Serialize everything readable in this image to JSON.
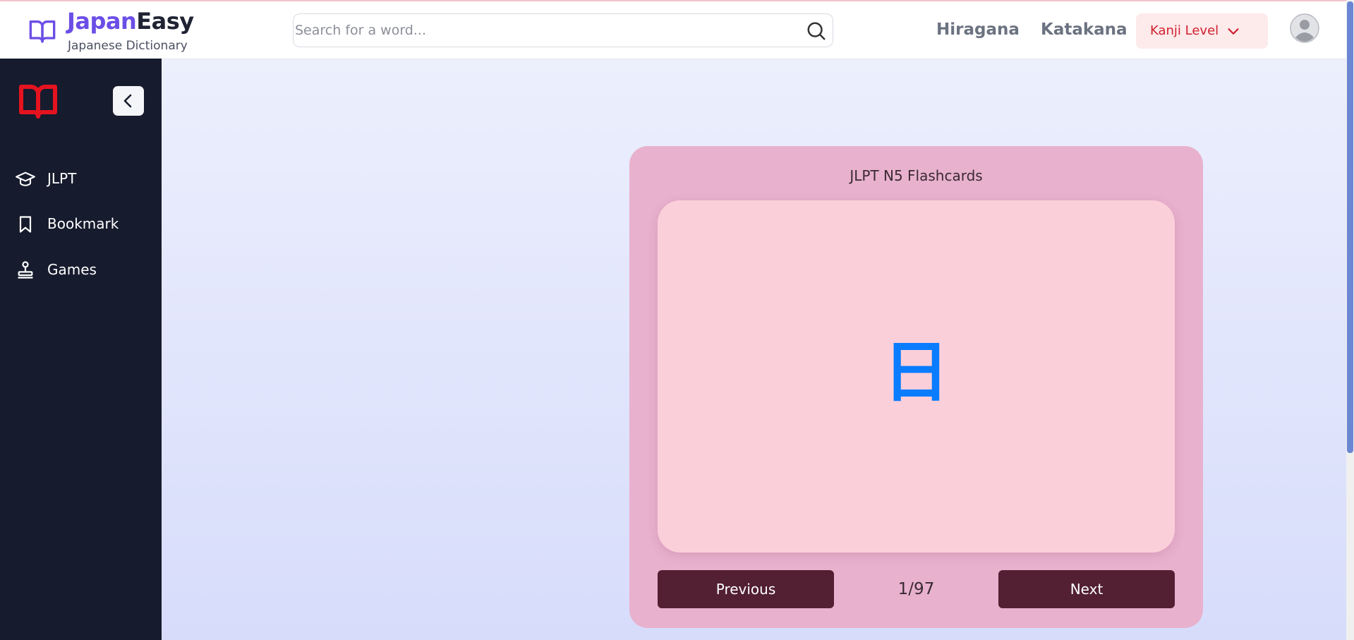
{
  "header": {
    "brand_part1": "Japan",
    "brand_part2": "Easy",
    "subtitle": "Japanese Dictionary",
    "search_placeholder": "Search for a word...",
    "nav": [
      "Hiragana",
      "Katakana"
    ],
    "kanji_level_label": "Kanji Level",
    "icons": {
      "logo": "open-book-icon",
      "search": "search-icon",
      "dropdown": "chevron-down-icon",
      "avatar": "user-avatar-icon"
    }
  },
  "sidebar": {
    "items": [
      {
        "label": "JLPT",
        "icon": "graduation-cap-icon"
      },
      {
        "label": "Bookmark",
        "icon": "bookmark-icon"
      },
      {
        "label": "Games",
        "icon": "joystick-icon"
      }
    ],
    "icons": {
      "logo": "open-book-icon",
      "collapse": "chevron-left-icon"
    }
  },
  "flashcards": {
    "title": "JLPT N5 Flashcards",
    "character": "日",
    "previous_label": "Previous",
    "next_label": "Next",
    "counter": "1/97"
  },
  "colors": {
    "brand_accent": "#6b4ee6",
    "sidebar_bg": "#161b2d",
    "kanji_level_text": "#d0202f",
    "panel_bg": "#e8b1ce",
    "card_bg": "#facfd9",
    "character": "#0a7cff",
    "button_bg": "#521f33",
    "sidebar_logo": "#e5131f"
  }
}
